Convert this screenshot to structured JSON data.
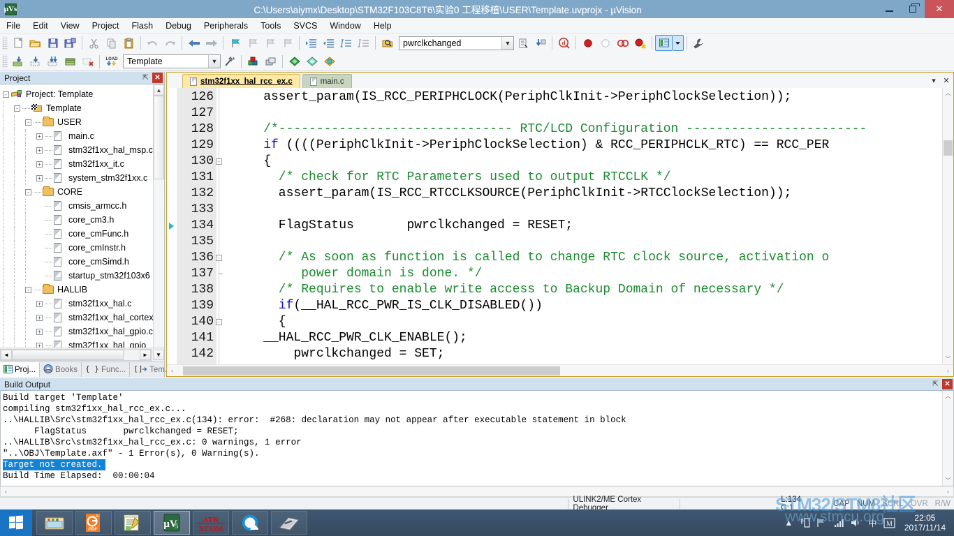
{
  "window": {
    "title": "C:\\Users\\aiymx\\Desktop\\STM32F103C8T6\\实验0 工程移植\\USER\\Template.uvprojx - µVision",
    "app_logo_text": "µVs",
    "minimize_label": "Minimize",
    "maximize_label": "Restore",
    "close_label": "✕"
  },
  "menu": {
    "items": [
      "File",
      "Edit",
      "View",
      "Project",
      "Flash",
      "Debug",
      "Peripherals",
      "Tools",
      "SVCS",
      "Window",
      "Help"
    ]
  },
  "toolbar": {
    "target_combo_value": "Template",
    "symbol_combo_value": "pwrclkchanged",
    "row1_icons": [
      "new-file-icon",
      "open-file-icon",
      "save-icon",
      "save-all-icon",
      "cut-icon",
      "copy-icon",
      "paste-icon",
      "undo-icon",
      "redo-icon",
      "navigate-back-icon",
      "navigate-forward-icon",
      "bookmark-toggle-icon",
      "bookmark-prev-icon",
      "bookmark-next-icon",
      "bookmark-clear-icon",
      "indent-icon",
      "outdent-icon",
      "comment-icon",
      "uncomment-icon"
    ],
    "row2_icons": [
      "build-icon",
      "rebuild-icon",
      "build-all-icon",
      "batch-build-icon",
      "stop-build-icon",
      "download-icon",
      "target-options-icon",
      "manage-projects-icon",
      "manage-components-icon",
      "configuration-wizard-icon",
      "pack-installer-icon",
      "pack-icon"
    ],
    "debug_icons": [
      "find-in-files-icon",
      "insert-bookmark-icon",
      "goto-icon",
      "start-debug-icon",
      "breakpoint-icon",
      "disable-breakpoint-icon",
      "disable-all-breakpoints-icon",
      "kill-all-breakpoints-icon",
      "window-layout-icon",
      "dropdown-arrow-icon",
      "customize-tools-icon"
    ]
  },
  "project_panel": {
    "title": "Project",
    "pin_label": "⇱",
    "close_label": "✕",
    "tree": [
      {
        "indent": 0,
        "toggle": "-",
        "icon": "project-icon",
        "label": "Project: Template"
      },
      {
        "indent": 1,
        "toggle": "-",
        "icon": "target-icon",
        "label": "Template"
      },
      {
        "indent": 2,
        "toggle": "-",
        "icon": "folder-icon",
        "label": "USER"
      },
      {
        "indent": 3,
        "toggle": "+",
        "icon": "file-icon",
        "label": "main.c"
      },
      {
        "indent": 3,
        "toggle": "+",
        "icon": "file-icon",
        "label": "stm32f1xx_hal_msp.c"
      },
      {
        "indent": 3,
        "toggle": "+",
        "icon": "file-icon",
        "label": "stm32f1xx_it.c"
      },
      {
        "indent": 3,
        "toggle": "+",
        "icon": "file-icon",
        "label": "system_stm32f1xx.c"
      },
      {
        "indent": 2,
        "toggle": "-",
        "icon": "folder-icon",
        "label": "CORE"
      },
      {
        "indent": 3,
        "toggle": "",
        "icon": "file-icon",
        "label": "cmsis_armcc.h"
      },
      {
        "indent": 3,
        "toggle": "",
        "icon": "file-icon",
        "label": "core_cm3.h"
      },
      {
        "indent": 3,
        "toggle": "",
        "icon": "file-icon",
        "label": "core_cmFunc.h"
      },
      {
        "indent": 3,
        "toggle": "",
        "icon": "file-icon",
        "label": "core_cmInstr.h"
      },
      {
        "indent": 3,
        "toggle": "",
        "icon": "file-icon",
        "label": "core_cmSimd.h"
      },
      {
        "indent": 3,
        "toggle": "",
        "icon": "asm-file-icon",
        "label": "startup_stm32f103x6"
      },
      {
        "indent": 2,
        "toggle": "-",
        "icon": "folder-icon",
        "label": "HALLIB"
      },
      {
        "indent": 3,
        "toggle": "+",
        "icon": "file-icon",
        "label": "stm32f1xx_hal.c"
      },
      {
        "indent": 3,
        "toggle": "+",
        "icon": "file-icon",
        "label": "stm32f1xx_hal_cortex"
      },
      {
        "indent": 3,
        "toggle": "+",
        "icon": "file-icon",
        "label": "stm32f1xx_hal_gpio.c"
      },
      {
        "indent": 3,
        "toggle": "+",
        "icon": "file-icon",
        "label": "stm32f1xx_hal_gpio_"
      }
    ],
    "tabs": [
      {
        "label": "Proj...",
        "icon": "project-tab-icon",
        "selected": true
      },
      {
        "label": "Books",
        "icon": "books-tab-icon",
        "selected": false
      },
      {
        "label": "Func...",
        "icon": "functions-tab-icon",
        "selected": false
      },
      {
        "label": "Tem...",
        "icon": "templates-tab-icon",
        "selected": false
      }
    ]
  },
  "editor": {
    "tabs": [
      {
        "label": "stm32f1xx_hal_rcc_ex.c",
        "active": true
      },
      {
        "label": "main.c",
        "active": false
      }
    ],
    "header_buttons": [
      "chevron-down-icon",
      "close-icon"
    ],
    "first_line_number": 126,
    "current_marker_line": 134,
    "lines": [
      {
        "num": 126,
        "fold": "",
        "segments": [
          {
            "t": "    assert_param(IS_RCC_PERIPHCLOCK(PeriphClkInit->PeriphClockSelection));",
            "c": "plain"
          }
        ]
      },
      {
        "num": 127,
        "fold": "",
        "segments": [
          {
            "t": "",
            "c": "plain"
          }
        ]
      },
      {
        "num": 128,
        "fold": "",
        "segments": [
          {
            "t": "    /*------------------------------- RTC/LCD Configuration ------------------------",
            "c": "cmt"
          }
        ]
      },
      {
        "num": 129,
        "fold": "",
        "segments": [
          {
            "t": "    if",
            "c": "kw"
          },
          {
            "t": " ((((PeriphClkInit->PeriphClockSelection) & RCC_PERIPHCLK_RTC) == RCC_PER",
            "c": "plain"
          }
        ]
      },
      {
        "num": 130,
        "fold": "-",
        "segments": [
          {
            "t": "    {",
            "c": "plain"
          }
        ]
      },
      {
        "num": 131,
        "fold": "",
        "segments": [
          {
            "t": "      /* check for RTC Parameters used to output RTCCLK */",
            "c": "cmt"
          }
        ]
      },
      {
        "num": 132,
        "fold": "",
        "segments": [
          {
            "t": "      assert_param(IS_RCC_RTCCLKSOURCE(PeriphClkInit->RTCClockSelection));",
            "c": "plain"
          }
        ]
      },
      {
        "num": 133,
        "fold": "",
        "segments": [
          {
            "t": "",
            "c": "plain"
          }
        ]
      },
      {
        "num": 134,
        "fold": "",
        "segments": [
          {
            "t": "      FlagStatus       pwrclkchanged = RESET;",
            "c": "plain"
          }
        ]
      },
      {
        "num": 135,
        "fold": "",
        "segments": [
          {
            "t": "",
            "c": "plain"
          }
        ]
      },
      {
        "num": 136,
        "fold": "-",
        "segments": [
          {
            "t": "      /* As soon as function is called to change RTC clock source, activation o",
            "c": "cmt"
          }
        ]
      },
      {
        "num": 137,
        "fold": "|",
        "segments": [
          {
            "t": "         power domain is done. */",
            "c": "cmt"
          }
        ]
      },
      {
        "num": 138,
        "fold": "",
        "segments": [
          {
            "t": "      /* Requires to enable write access to Backup Domain of necessary */",
            "c": "cmt"
          }
        ]
      },
      {
        "num": 139,
        "fold": "",
        "segments": [
          {
            "t": "      if",
            "c": "kw"
          },
          {
            "t": "(__HAL_RCC_PWR_IS_CLK_DISABLED())",
            "c": "plain"
          }
        ]
      },
      {
        "num": 140,
        "fold": "-",
        "segments": [
          {
            "t": "      {",
            "c": "plain"
          }
        ]
      },
      {
        "num": 141,
        "fold": "",
        "segments": [
          {
            "t": "    __HAL_RCC_PWR_CLK_ENABLE();",
            "c": "plain"
          }
        ]
      },
      {
        "num": 142,
        "fold": "",
        "segments": [
          {
            "t": "        pwrclkchanged = SET;",
            "c": "plain"
          }
        ]
      }
    ]
  },
  "build_output": {
    "title": "Build Output",
    "lines": [
      {
        "text": "Build target 'Template'",
        "selected": false
      },
      {
        "text": "compiling stm32f1xx_hal_rcc_ex.c...",
        "selected": false
      },
      {
        "text": "..\\HALLIB\\Src\\stm32f1xx_hal_rcc_ex.c(134): error:  #268: declaration may not appear after executable statement in block",
        "selected": false
      },
      {
        "text": "      FlagStatus       pwrclkchanged = RESET;",
        "selected": false
      },
      {
        "text": "..\\HALLIB\\Src\\stm32f1xx_hal_rcc_ex.c: 0 warnings, 1 error",
        "selected": false
      },
      {
        "text": "\"..\\OBJ\\Template.axf\" - 1 Error(s), 0 Warning(s).",
        "selected": false
      },
      {
        "text": "Target not created.",
        "selected": true
      },
      {
        "text": "Build Time Elapsed:  00:00:04",
        "selected": false
      }
    ]
  },
  "statusbar": {
    "debugger": "ULINK2/ME Cortex Debugger",
    "position": "L:134 C:1",
    "flags": [
      {
        "label": "CAP",
        "on": true
      },
      {
        "label": "NUM",
        "on": true
      },
      {
        "label": "SCRL",
        "on": false
      },
      {
        "label": "OVR",
        "on": false
      },
      {
        "label": "R/W",
        "on": false
      }
    ]
  },
  "taskbar": {
    "start_label": "Start",
    "items": [
      {
        "name": "file-explorer-task",
        "icon": "folder-icon"
      },
      {
        "name": "pdf-reader-task",
        "icon": "pdf-icon",
        "label": "PDF"
      },
      {
        "name": "notepad-task",
        "icon": "notepad-icon"
      },
      {
        "name": "keil-uvision-task",
        "icon": "uvision-icon",
        "label": "µVs",
        "active": true
      },
      {
        "name": "atk-xcom-task",
        "icon": "atk-xcom-icon",
        "label_top": "ATK",
        "label_bottom": "XCOM"
      },
      {
        "name": "browser-task",
        "icon": "browser-icon"
      },
      {
        "name": "dictionary-task",
        "icon": "book-icon"
      }
    ],
    "tray_icons": [
      "show-hidden-icons-arrow",
      "usb-device-icon",
      "network-flag-icon",
      "signal-bars-icon",
      "volume-icon",
      "ime-chinese-icon",
      "ime-m-icon"
    ],
    "clock_time": "22:05",
    "clock_date": "2017/11/14"
  },
  "watermark": {
    "line1": "STM32/STM8社区",
    "line2": "www.stmcu.org"
  },
  "colors": {
    "titlebar": "#7fa7c8",
    "close_button": "#c9555a",
    "accent_selection": "#1383d6",
    "comment_green": "#1b8b2f",
    "keyword_blue": "#1414d0",
    "active_tab_yellow": "#ffe9a8",
    "inactive_tab_green": "#c9d6bf"
  }
}
